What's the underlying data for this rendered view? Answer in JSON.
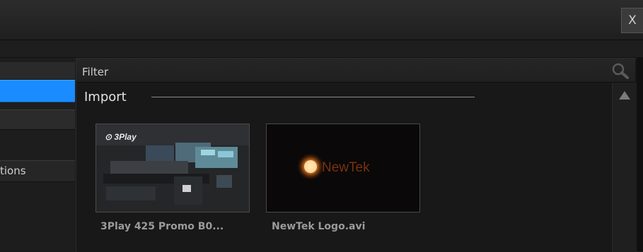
{
  "window": {
    "close_label": "X"
  },
  "sidebar": {
    "items": [
      {
        "label": ""
      },
      {
        "label": ""
      },
      {
        "label": ""
      },
      {
        "label": "tions"
      }
    ]
  },
  "filter": {
    "label": "Filter"
  },
  "section": {
    "title": "Import"
  },
  "media": [
    {
      "name": "3Play 425 Promo B0...",
      "thumb_icon": "3play-promo-thumbnail"
    },
    {
      "name": "NewTek Logo.avi",
      "thumb_icon": "newtek-logo-thumbnail"
    }
  ],
  "colors": {
    "accent": "#1a8cff",
    "background": "#181818"
  }
}
